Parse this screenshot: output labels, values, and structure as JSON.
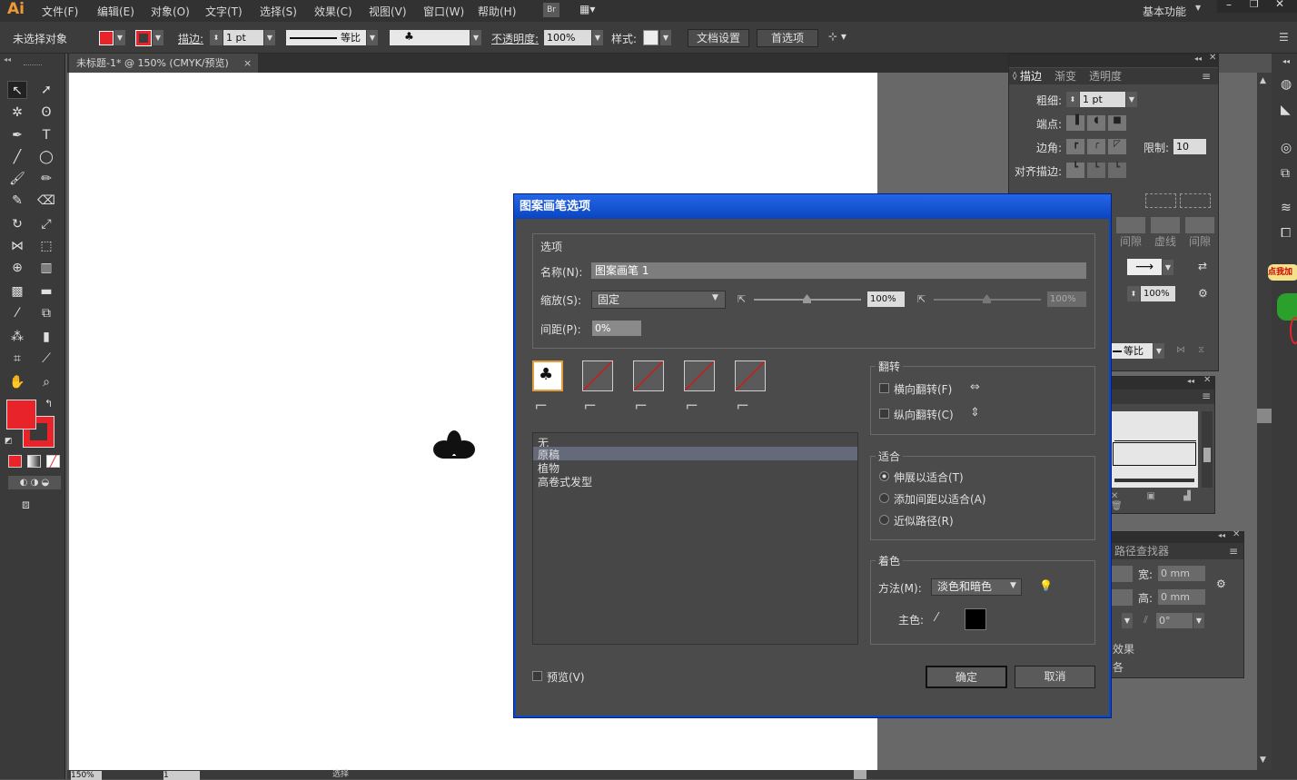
{
  "menubar": {
    "logo": "Ai",
    "items": [
      "文件(F)",
      "编辑(E)",
      "对象(O)",
      "文字(T)",
      "选择(S)",
      "效果(C)",
      "视图(V)",
      "窗口(W)",
      "帮助(H)"
    ],
    "bridge": "Br",
    "workspace": "基本功能"
  },
  "control": {
    "selection": "未选择对象",
    "stroke_label": "描边:",
    "stroke_weight": "1 pt",
    "profile": "等比",
    "opacity_label": "不透明度:",
    "opacity": "100%",
    "style_label": "样式:",
    "doc_setup": "文档设置",
    "preferences": "首选项"
  },
  "document": {
    "tab": "未标题-1* @ 150% (CMYK/预览)"
  },
  "stroke_panel": {
    "tabs": [
      "描边",
      "渐变",
      "透明度"
    ],
    "weight_label": "粗细:",
    "weight": "1 pt",
    "cap_label": "端点:",
    "corner_label": "边角:",
    "limit_label": "限制:",
    "limit": "10",
    "align_label": "对齐描边:",
    "dash_labels": [
      "间隙",
      "虚线",
      "间隙"
    ],
    "scale": "100%",
    "profile": "等比"
  },
  "transform_panel": {
    "title": "路径查找器",
    "width_label": "宽:",
    "width": "0 mm",
    "height_label": "高:",
    "height": "0 mm",
    "angle": "0°",
    "effects": "效果"
  },
  "dialog": {
    "title": "图案画笔选项",
    "options_label": "选项",
    "name_label": "名称(N):",
    "name_value": "图案画笔 1",
    "scale_label": "缩放(S):",
    "scale_value": "固定",
    "scale_pct1": "100%",
    "scale_pct2": "100%",
    "spacing_label": "间距(P):",
    "spacing_value": "0%",
    "list_items": [
      "无",
      "原稿",
      "植物",
      "高卷式发型"
    ],
    "selected_item": "原稿",
    "flip_label": "翻转",
    "flip_h": "横向翻转(F)",
    "flip_v": "纵向翻转(C)",
    "fit_label": "适合",
    "fit_options": [
      "伸展以适合(T)",
      "添加间距以适合(A)",
      "近似路径(R)"
    ],
    "color_label": "着色",
    "method_label": "方法(M):",
    "method_value": "淡色和暗色",
    "key_color_label": "主色:",
    "preview_label": "预览(V)",
    "ok": "确定",
    "cancel": "取消"
  },
  "status": {
    "zoom": "150%",
    "page": "1",
    "tool": "选择"
  },
  "promo": "点我加",
  "colors": {
    "fill": "#e8232a",
    "accent_orange": "#e8a04a",
    "dialog_blue": "#0a49c8"
  }
}
